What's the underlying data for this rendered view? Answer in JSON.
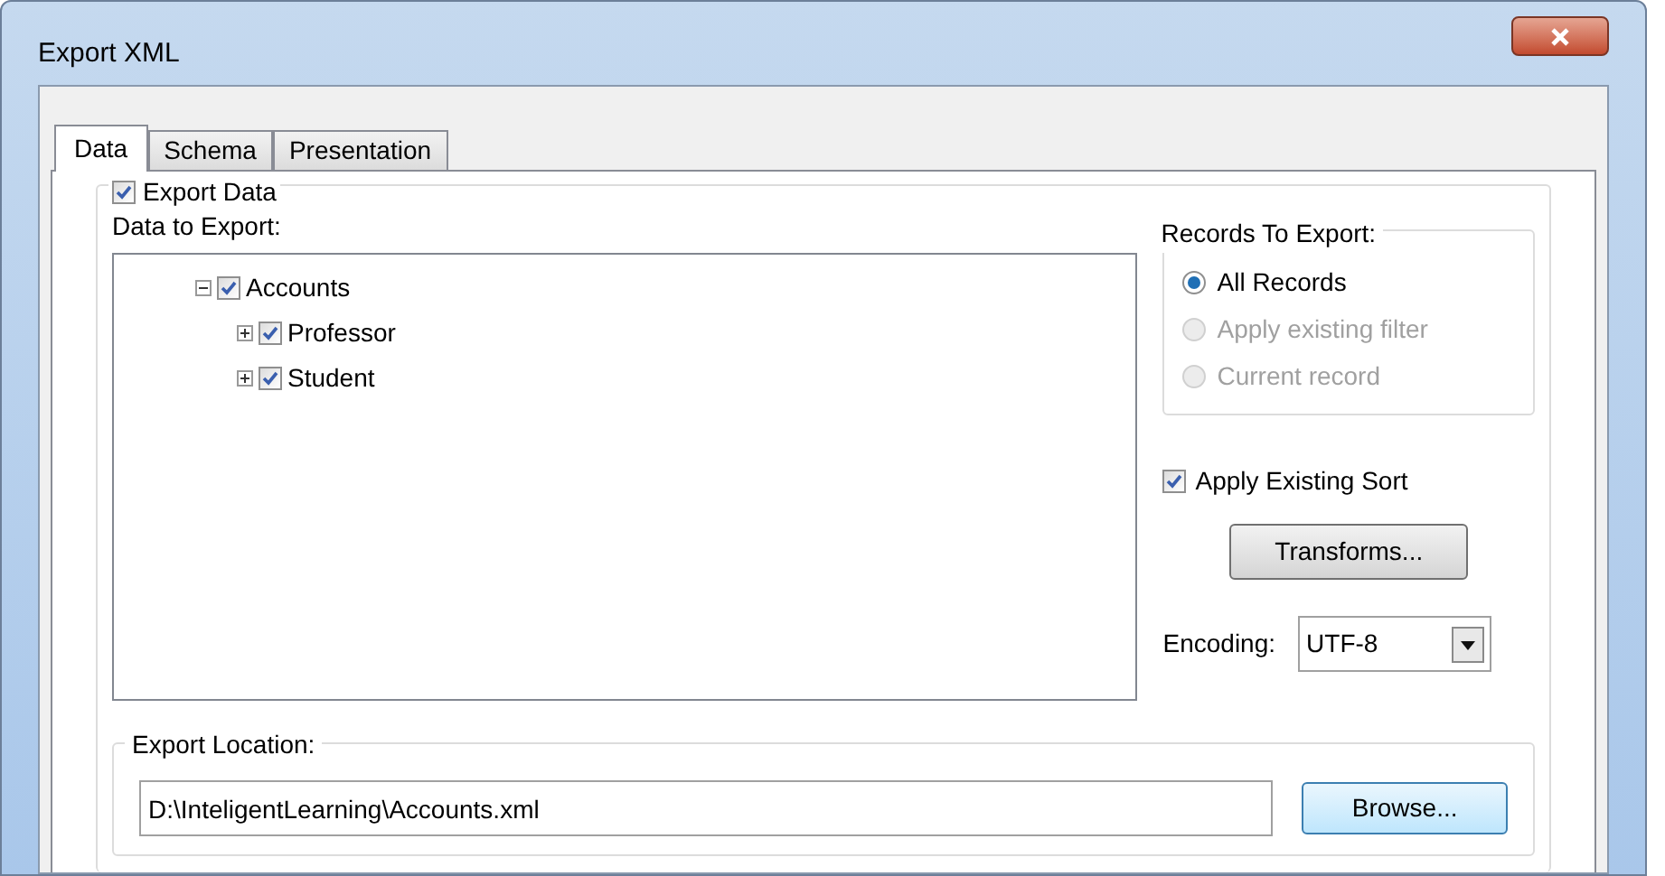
{
  "window": {
    "title": "Export XML"
  },
  "tabs": [
    {
      "label": "Data",
      "selected": true
    },
    {
      "label": "Schema",
      "selected": false
    },
    {
      "label": "Presentation",
      "selected": false
    }
  ],
  "export_data": {
    "label": "Export Data",
    "checked": true
  },
  "data_to_export": {
    "label": "Data to Export:",
    "tree": [
      {
        "label": "Accounts",
        "checked": true,
        "expanded": true,
        "children": [
          {
            "label": "Professor",
            "checked": true,
            "expanded": false
          },
          {
            "label": "Student",
            "checked": true,
            "expanded": false
          }
        ]
      }
    ]
  },
  "records_to_export": {
    "label": "Records To Export:",
    "options": [
      {
        "label": "All Records",
        "selected": true,
        "disabled": false
      },
      {
        "label": "Apply existing filter",
        "selected": false,
        "disabled": true
      },
      {
        "label": "Current record",
        "selected": false,
        "disabled": true
      }
    ]
  },
  "apply_existing_sort": {
    "label": "Apply Existing Sort",
    "checked": true
  },
  "transforms_button": "Transforms...",
  "encoding": {
    "label": "Encoding:",
    "value": "UTF-8"
  },
  "export_location": {
    "label": "Export Location:",
    "value": "D:\\InteligentLearning\\Accounts.xml",
    "button": "Browse..."
  }
}
